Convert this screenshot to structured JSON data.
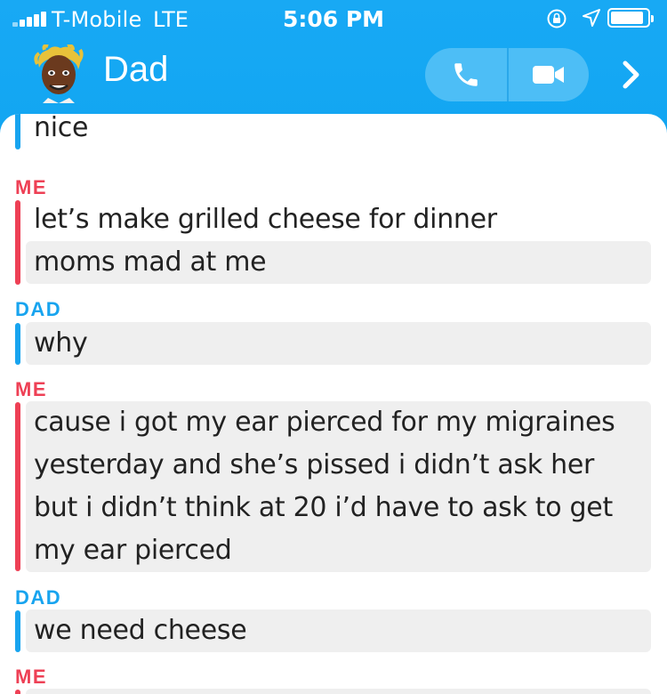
{
  "status_bar": {
    "carrier": "T-Mobile",
    "network": "LTE",
    "time": "5:06 PM",
    "battery_level": 0.9
  },
  "header": {
    "contact_name": "Dad",
    "avatar_icon": "bitmoji-avatar",
    "call_icon": "phone-icon",
    "video_icon": "video-camera-icon",
    "more_icon": "chevron-right-icon",
    "accent_color": "#12a6f2"
  },
  "colors": {
    "me": "#ee4055",
    "dad": "#18a4ef",
    "bubble_bg": "#efefef"
  },
  "conversation": [
    {
      "sender": "",
      "messages": [
        "nice"
      ]
    },
    {
      "sender": "ME",
      "messages": [
        "let’s make grilled cheese for dinner",
        "moms mad at me"
      ]
    },
    {
      "sender": "DAD",
      "messages": [
        "why"
      ]
    },
    {
      "sender": "ME",
      "messages": [
        "cause i got my ear pierced for my migraines yesterday and she’s pissed i didn’t ask her but i didn’t think at 20 i’d have to ask to get my ear pierced"
      ]
    },
    {
      "sender": "DAD",
      "messages": [
        "we need cheese"
      ]
    },
    {
      "sender": "ME",
      "messages": []
    }
  ]
}
